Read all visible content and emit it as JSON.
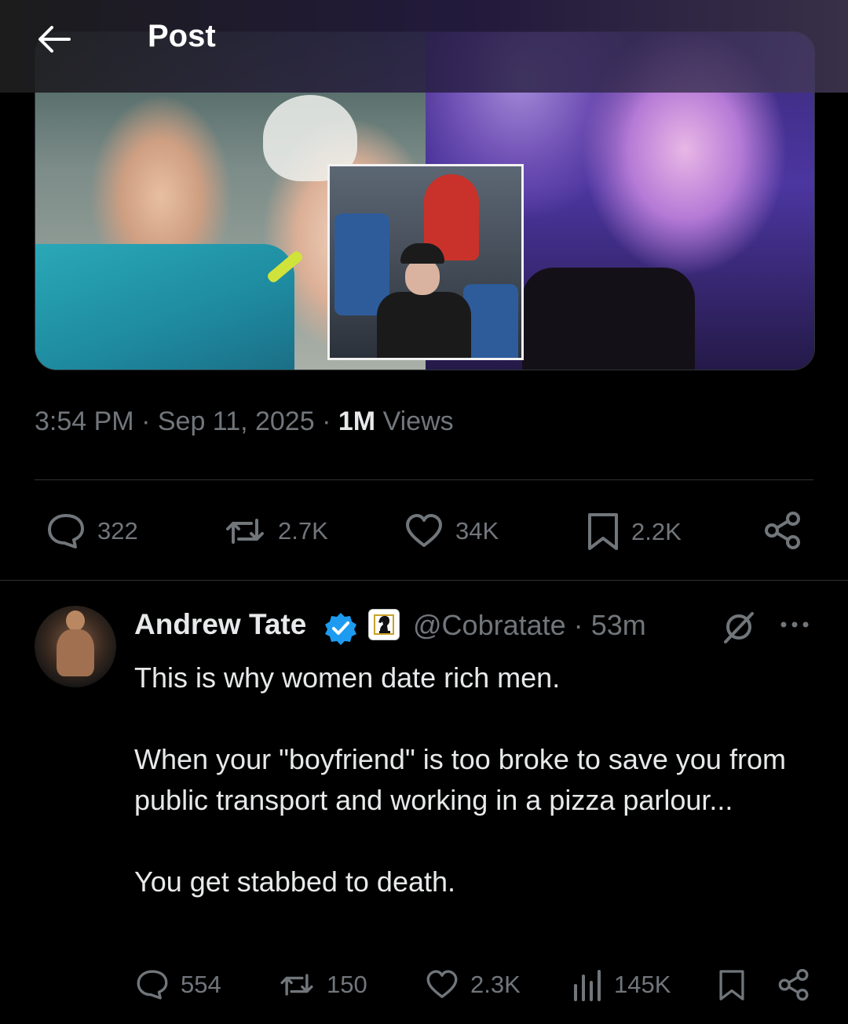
{
  "header": {
    "title": "Post"
  },
  "post": {
    "time": "3:54 PM",
    "date": "Sep 11, 2025",
    "views_count": "1M",
    "views_label": "Views",
    "stats": {
      "replies": "322",
      "reposts": "2.7K",
      "likes": "34K",
      "bookmarks": "2.2K"
    }
  },
  "reply": {
    "author_name": "Andrew Tate",
    "handle": "@Cobratate",
    "separator": "·",
    "age": "53m",
    "text": [
      "This is why women date rich men.",
      "When your \"boyfriend\" is too broke to save you from public transport and working in a pizza parlour...",
      "You get stabbed to death."
    ],
    "stats": {
      "replies": "554",
      "reposts": "150",
      "likes": "2.3K",
      "views": "145K"
    }
  },
  "colors": {
    "background": "#000000",
    "text_primary": "#e7e9ea",
    "text_secondary": "#71767b",
    "verified_blue": "#1d9bf0",
    "divider": "#2f3336"
  },
  "icons": {
    "back": "arrow-left-icon",
    "reply": "speech-bubble-icon",
    "repost": "repost-arrows-icon",
    "like": "heart-icon",
    "bookmark": "bookmark-icon",
    "share": "share-icon",
    "views": "bar-chart-icon",
    "verified": "verified-badge-icon",
    "affiliate": "chess-knight-icon",
    "grok": "grok-icon",
    "more": "more-dots-icon"
  }
}
